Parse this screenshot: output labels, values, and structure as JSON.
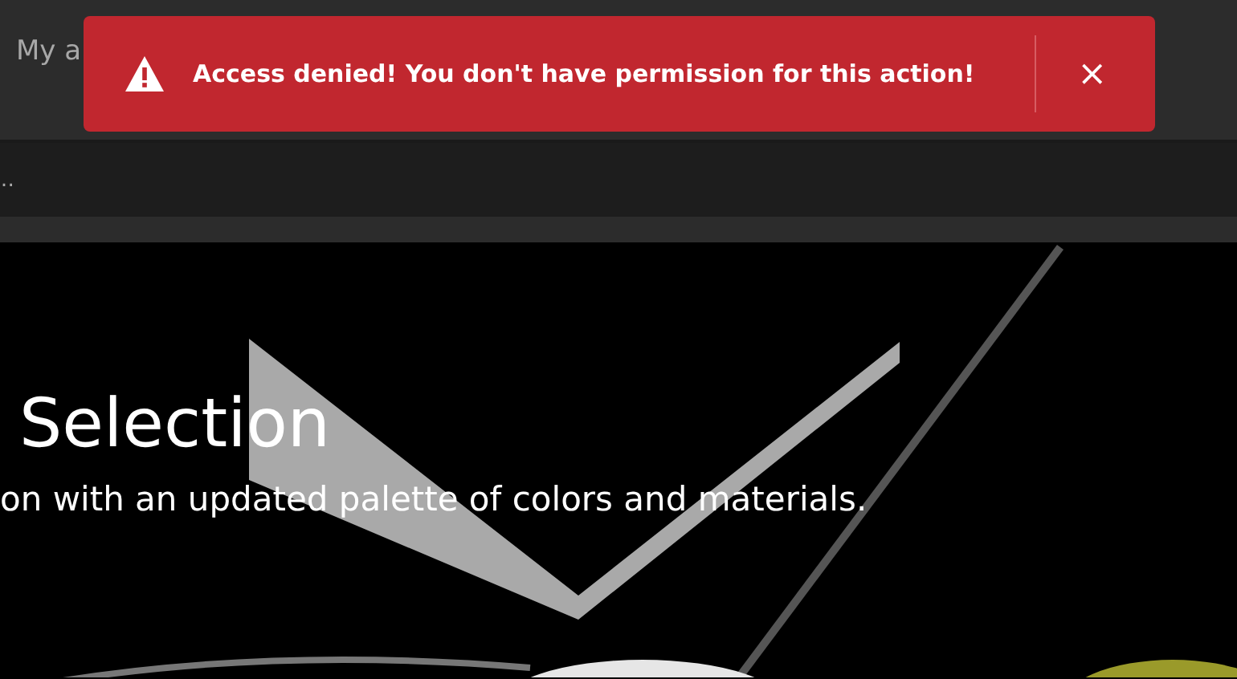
{
  "header": {
    "nav_text": "My a"
  },
  "toolbar": {
    "text": "…"
  },
  "hero": {
    "title": "Selection",
    "subtitle": "on with an updated palette of colors and materials."
  },
  "toast": {
    "kind": "error",
    "message": "Access denied! You don't have permission for this action!",
    "close": "×"
  }
}
